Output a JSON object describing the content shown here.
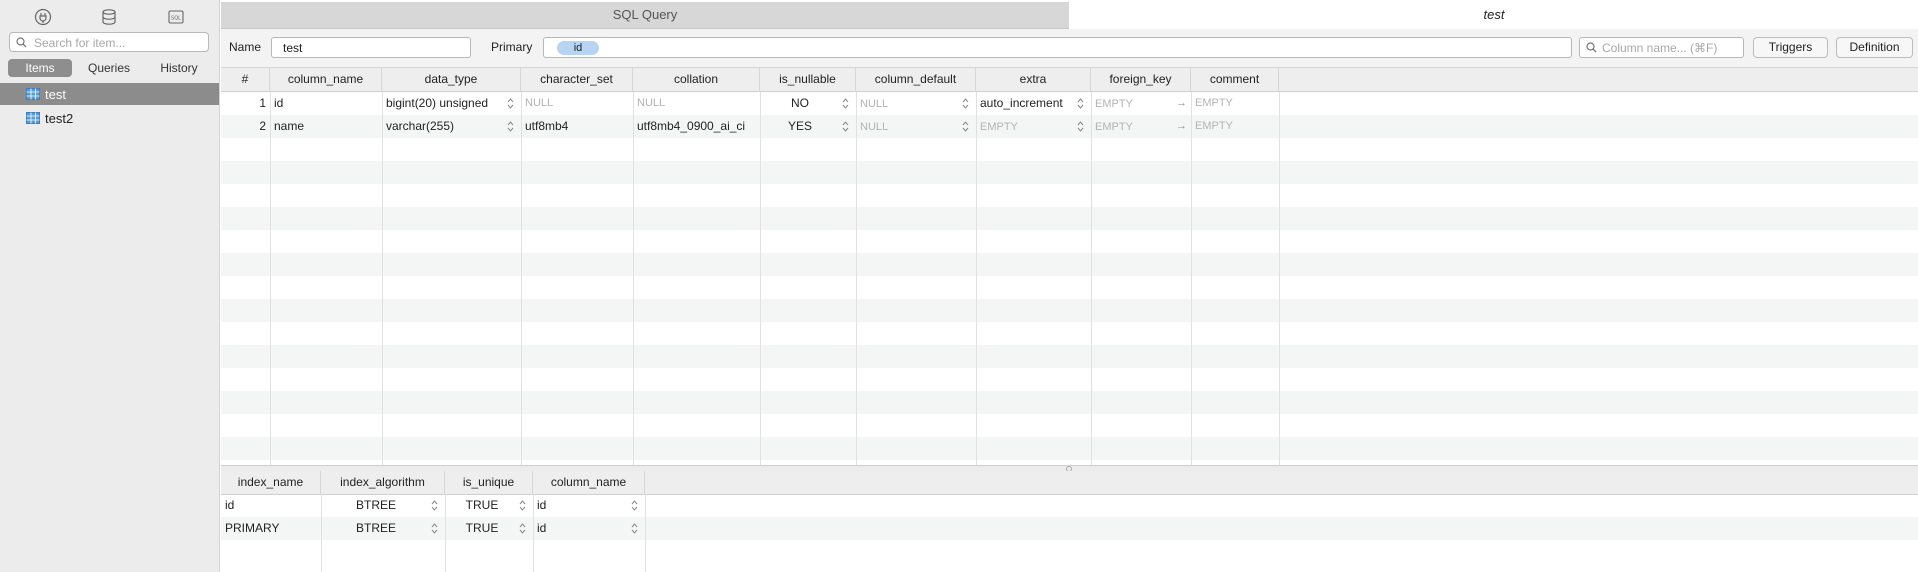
{
  "sidebar": {
    "search_placeholder": "Search for item...",
    "segments": [
      "Items",
      "Queries",
      "History"
    ],
    "items": [
      "test",
      "test2"
    ]
  },
  "tabs": {
    "sql_query": "SQL Query",
    "active_table": "test"
  },
  "toolbar": {
    "name_label": "Name",
    "name_value": "test",
    "primary_label": "Primary",
    "primary_token": "id",
    "column_search_placeholder": "Column name... (⌘F)",
    "triggers_label": "Triggers",
    "definition_label": "Definition"
  },
  "columns_grid": {
    "headers": [
      "#",
      "column_name",
      "data_type",
      "character_set",
      "collation",
      "is_nullable",
      "column_default",
      "extra",
      "foreign_key",
      "comment"
    ],
    "rows": [
      {
        "num": "1",
        "column_name": "id",
        "data_type": "bigint(20) unsigned",
        "character_set": "NULL",
        "collation": "NULL",
        "is_nullable": "NO",
        "column_default": "NULL",
        "extra": "auto_increment",
        "foreign_key": "EMPTY",
        "comment": "EMPTY"
      },
      {
        "num": "2",
        "column_name": "name",
        "data_type": "varchar(255)",
        "character_set": "utf8mb4",
        "collation": "utf8mb4_0900_ai_ci",
        "is_nullable": "YES",
        "column_default": "NULL",
        "extra": "EMPTY",
        "foreign_key": "EMPTY",
        "comment": "EMPTY"
      }
    ]
  },
  "index_grid": {
    "headers": [
      "index_name",
      "index_algorithm",
      "is_unique",
      "column_name"
    ],
    "rows": [
      {
        "index_name": "id",
        "index_algorithm": "BTREE",
        "is_unique": "TRUE",
        "column_name": "id"
      },
      {
        "index_name": "PRIMARY",
        "index_algorithm": "BTREE",
        "is_unique": "TRUE",
        "column_name": "id"
      }
    ]
  },
  "colors": {
    "selection": "#8c8c8c",
    "token": "#b7d4f5",
    "sidebar_bg": "#ececec"
  }
}
